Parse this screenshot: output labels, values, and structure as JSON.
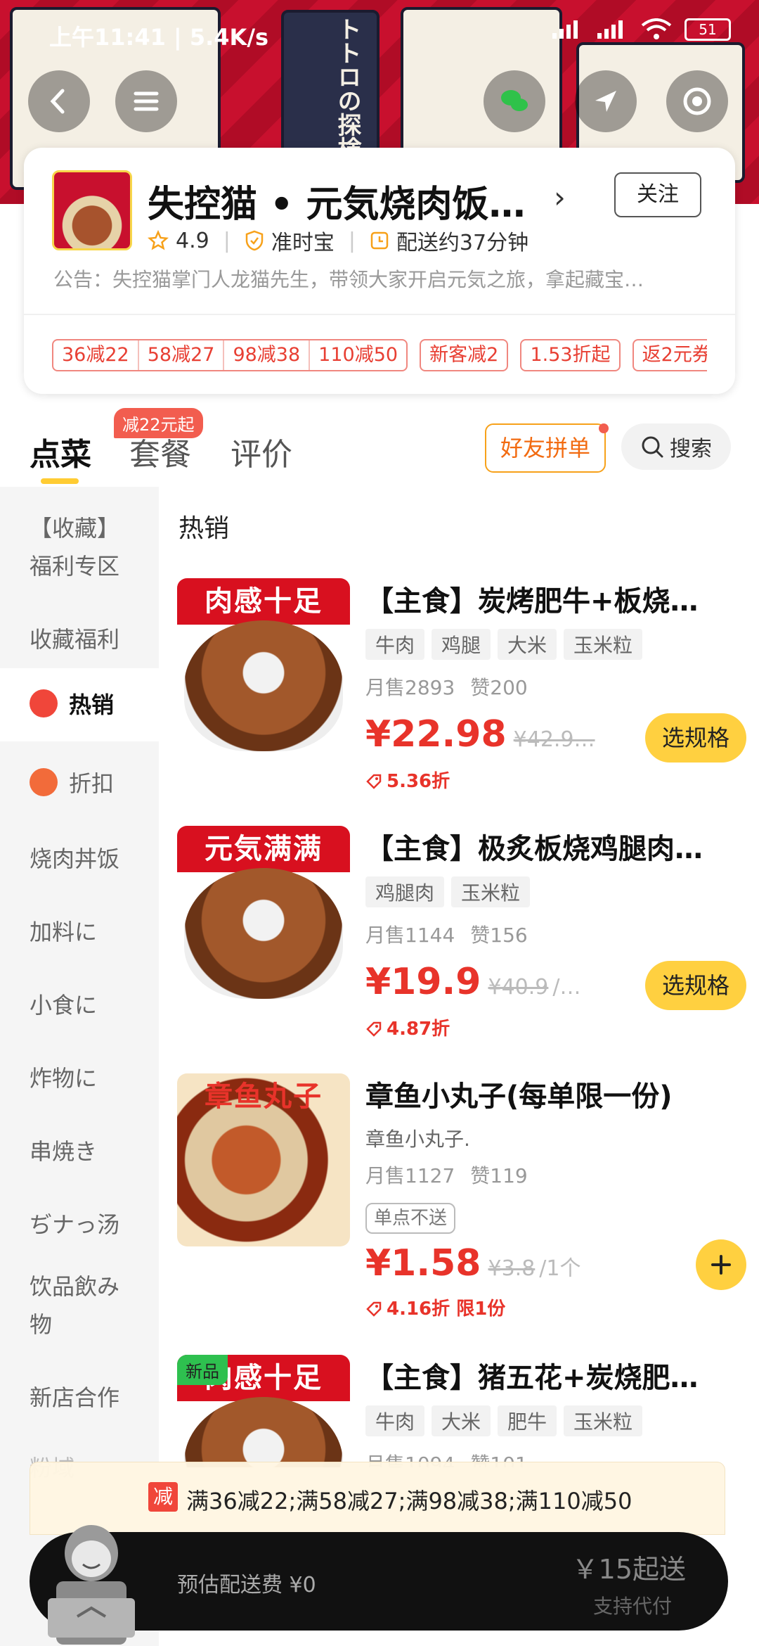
{
  "status_bar": {
    "time": "上午11:41 | 5.4K/s",
    "battery": "51"
  },
  "store": {
    "name": "失控猫 • 元気烧肉饭…",
    "follow_label": "关注",
    "rating": "4.9",
    "on_time": "准时宝",
    "delivery_time": "配送约37分钟",
    "notice": "公告：失控猫掌门人龙猫先生，带领大家开启元気之旅，拿起藏宝…",
    "coupons_group": [
      "36减22",
      "58减27",
      "98减38",
      "110减50"
    ],
    "coupons": [
      "新客减2",
      "1.53折起",
      "返2元券"
    ]
  },
  "tabs": {
    "order": "点菜",
    "combo": "套餐",
    "reviews": "评价",
    "combo_badge": "减22元起",
    "group_order": "好友拼单",
    "search": "搜索"
  },
  "sidebar": {
    "items": [
      "【收藏】\n福利专区",
      "收藏福利",
      "热销",
      "折扣",
      "烧肉丼饭",
      "加料に",
      "小食に",
      "炸物に",
      "串焼き",
      "ぢナっ汤",
      "饮品飲み\n物",
      "新店合作",
      "粉域"
    ]
  },
  "section_title": "热销",
  "products": [
    {
      "image_label": "肉感十足",
      "name": "【主食】炭烤肥牛+板烧…",
      "tags": [
        "牛肉",
        "鸡腿",
        "大米",
        "玉米粒"
      ],
      "sold": "月售2893",
      "likes": "赞200",
      "price": "¥22.98",
      "original": "¥42.9…",
      "discount": "5.36折",
      "action": "选规格"
    },
    {
      "image_label": "元気满满",
      "name": "【主食】极炙板烧鸡腿肉…",
      "tags": [
        "鸡腿肉",
        "玉米粒"
      ],
      "sold": "月售1144",
      "likes": "赞156",
      "price": "¥19.9",
      "original": "¥40.9",
      "unit": "/…",
      "discount": "4.87折",
      "action": "选规格"
    },
    {
      "image_label": "章鱼丸子",
      "name": "章鱼小丸子(每单限一份)",
      "desc": "章鱼小丸子.",
      "sold": "月售1127",
      "likes": "赞119",
      "badge": "单点不送",
      "price": "¥1.58",
      "original": "¥3.8",
      "unit": "/1个",
      "discount": "4.16折 限1份"
    },
    {
      "image_label": "肉感十足",
      "new_label": "新品",
      "name": "【主食】猪五花+炭烧肥…",
      "tags": [
        "牛肉",
        "大米",
        "肥牛",
        "玉米粒"
      ],
      "sold": "月售1094",
      "likes": "赞101"
    }
  ],
  "promo": {
    "tag": "减",
    "text": "满36减22;满58减27;满98减38;满110减50"
  },
  "cart": {
    "fee": "预估配送费 ¥0",
    "min_order": "￥15起送",
    "pay_for_other": "支持代付"
  },
  "colors": {
    "accent_red": "#e8332a",
    "brand_yellow": "#ffd040",
    "tab_underline": "#ffcc33"
  }
}
